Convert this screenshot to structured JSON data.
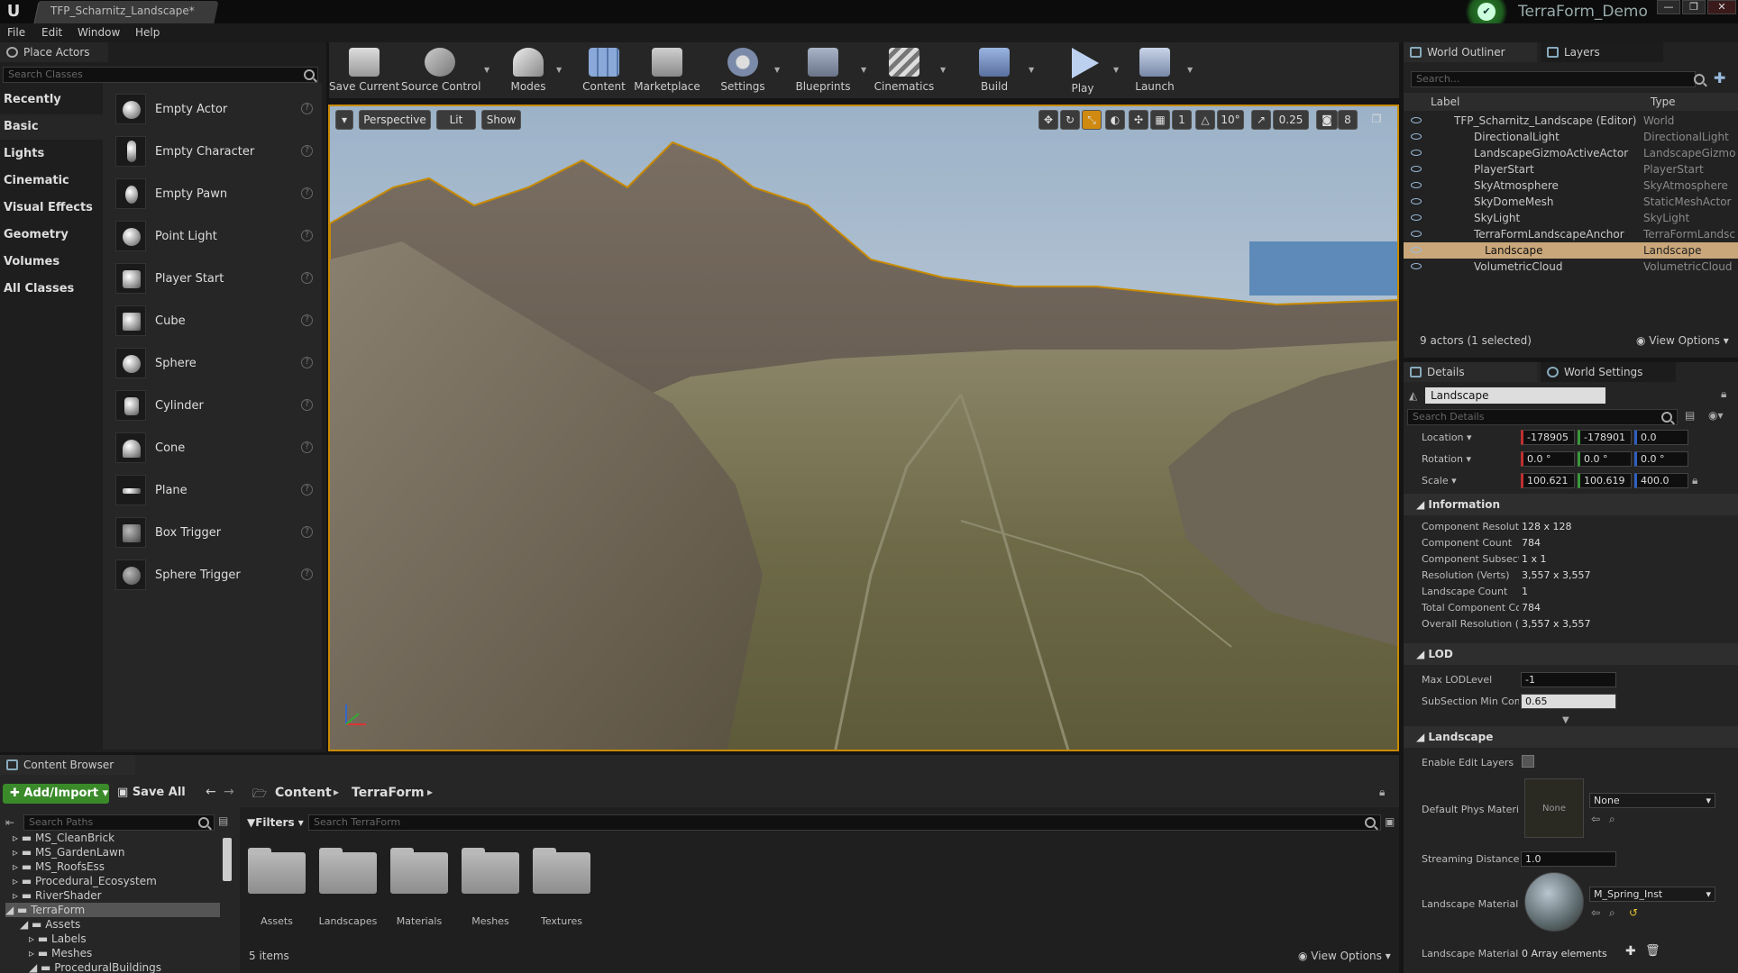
{
  "window": {
    "tab_title": "TFP_Scharnitz_Landscape*",
    "project_name": "TerraForm_Demo",
    "logo_text": "U",
    "controls": [
      "—",
      "❐",
      "✕"
    ]
  },
  "menu": [
    "File",
    "Edit",
    "Window",
    "Help"
  ],
  "place_actors": {
    "tab": "Place Actors",
    "search_placeholder": "Search Classes",
    "categories": [
      "Recently Placed",
      "Basic",
      "Lights",
      "Cinematic",
      "Visual Effects",
      "Geometry",
      "Volumes",
      "All Classes"
    ],
    "selected_category": "Basic",
    "actors": [
      "Empty Actor",
      "Empty Character",
      "Empty Pawn",
      "Point Light",
      "Player Start",
      "Cube",
      "Sphere",
      "Cylinder",
      "Cone",
      "Plane",
      "Box Trigger",
      "Sphere Trigger"
    ]
  },
  "toolbar": {
    "buttons": [
      "Save Current",
      "Source Control",
      "Modes",
      "Content",
      "Marketplace",
      "Settings",
      "Blueprints",
      "Cinematics",
      "Build",
      "Play",
      "Launch"
    ]
  },
  "viewport": {
    "perspective": "Perspective",
    "lit": "Lit",
    "show": "Show",
    "rotation_snap": "10°",
    "scale_snap": "0.25",
    "grid_snap": "1",
    "camera_speed": "8"
  },
  "outliner": {
    "tab": "World Outliner",
    "tab2": "Layers",
    "search_placeholder": "Search...",
    "col_label": "Label",
    "col_type": "Type",
    "rows": [
      {
        "label": "TFP_Scharnitz_Landscape (Editor)",
        "type": "World"
      },
      {
        "label": "DirectionalLight",
        "type": "DirectionalLight"
      },
      {
        "label": "LandscapeGizmoActiveActor",
        "type": "LandscapeGizmo"
      },
      {
        "label": "PlayerStart",
        "type": "PlayerStart"
      },
      {
        "label": "SkyAtmosphere",
        "type": "SkyAtmosphere"
      },
      {
        "label": "SkyDomeMesh",
        "type": "StaticMeshActor"
      },
      {
        "label": "SkyLight",
        "type": "SkyLight"
      },
      {
        "label": "TerraFormLandscapeAnchor",
        "type": "TerraFormLandsc"
      },
      {
        "label": "Landscape",
        "type": "Landscape"
      },
      {
        "label": "VolumetricCloud",
        "type": "VolumetricCloud"
      }
    ],
    "status": "9 actors (1 selected)",
    "view_options": "View Options"
  },
  "details": {
    "tab": "Details",
    "tab2": "World Settings",
    "name": "Landscape",
    "search_placeholder": "Search Details",
    "location_label": "Location",
    "rotation_label": "Rotation",
    "scale_label": "Scale",
    "location": [
      "-178905",
      "-178901",
      "0.0"
    ],
    "rotation": [
      "0.0 °",
      "0.0 °",
      "0.0 °"
    ],
    "scale": [
      "100.621",
      "100.619",
      "400.0"
    ],
    "information_title": "Information",
    "information": [
      {
        "k": "Component Resoluti",
        "v": "128 x 128"
      },
      {
        "k": "Component Count",
        "v": "784"
      },
      {
        "k": "Component Subsecti",
        "v": "1 x 1"
      },
      {
        "k": "Resolution (Verts)",
        "v": "3,557 x 3,557"
      },
      {
        "k": "Landscape Count",
        "v": "1"
      },
      {
        "k": "Total Component Co",
        "v": "784"
      },
      {
        "k": "Overall Resolution (V",
        "v": "3,557 x 3,557"
      }
    ],
    "lod_title": "LOD",
    "max_lod_label": "Max LODLevel",
    "max_lod": "-1",
    "subsection_label": "SubSection Min Com",
    "subsection": "0.65",
    "landscape_title": "Landscape",
    "enable_edit_layers": "Enable Edit Layers",
    "phys_material_label": "Default Phys Materia",
    "phys_material_value": "None",
    "phys_thumb_text": "None",
    "streaming_label": "Streaming Distance I",
    "streaming_value": "1.0",
    "material_label": "Landscape Material",
    "material_value": "M_Spring_Inst",
    "materials_label": "Landscape Materials",
    "materials_value": "0 Array elements"
  },
  "content_browser": {
    "tab": "Content Browser",
    "add_import": "Add/Import",
    "save_all": "Save All",
    "breadcrumb": [
      "Content",
      "TerraForm"
    ],
    "search_paths_placeholder": "Search Paths",
    "filters": "Filters",
    "search_placeholder": "Search TerraForm",
    "tree": [
      "MS_CleanBrick",
      "MS_GardenLawn",
      "MS_RoofsEss",
      "Procedural_Ecosystem",
      "RiverShader",
      "TerraForm",
      "Assets",
      "Labels",
      "Meshes",
      "ProceduralBuildings"
    ],
    "folders": [
      "Assets",
      "Landscapes",
      "Materials",
      "Meshes",
      "Textures"
    ],
    "item_count": "5 items",
    "view_options": "View Options"
  }
}
